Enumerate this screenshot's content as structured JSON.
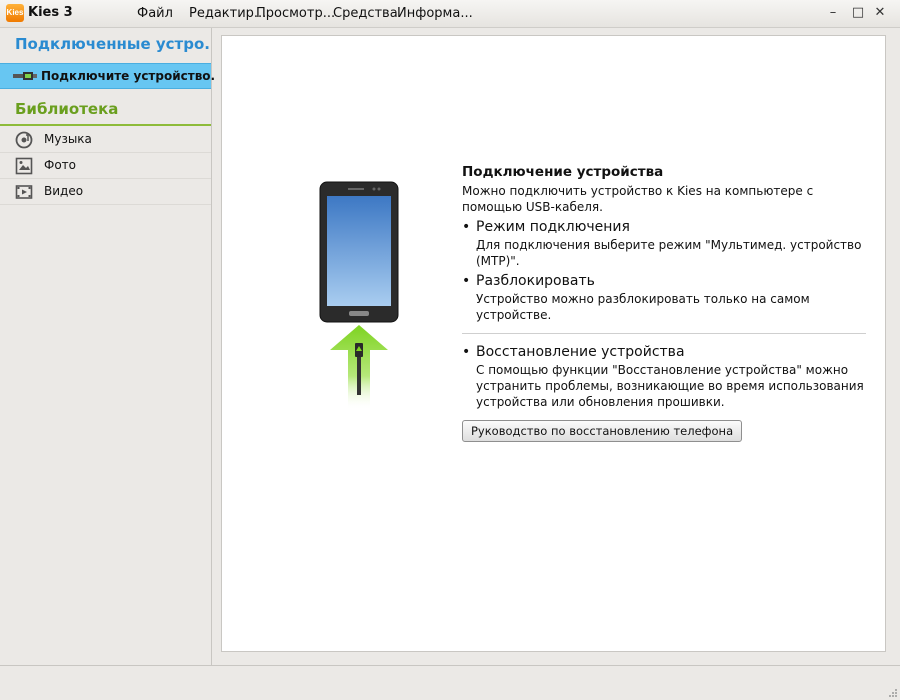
{
  "app": {
    "logo_text": "Kies",
    "title": "Kies 3",
    "accent_color": "#2a8bd1",
    "library_color": "#6a9f1e",
    "selection_color": "#67c6f2"
  },
  "menu": {
    "file": "Файл",
    "edit": "Редактир...",
    "view": "Просмотр...",
    "tools": "Средства",
    "info": "Информа..."
  },
  "window_controls": {
    "minimize": "–",
    "maximize": "□",
    "close": "✕"
  },
  "sidebar": {
    "devices_header": "Подключенные устро...",
    "device_row": "Подключите устройство.",
    "library_header": "Библиотека",
    "library_items": [
      {
        "label": "Музыка",
        "icon": "music-icon"
      },
      {
        "label": "Фото",
        "icon": "photo-icon"
      },
      {
        "label": "Видео",
        "icon": "video-icon"
      }
    ]
  },
  "content": {
    "title": "Подключение устройства",
    "intro": "Можно подключить устройство к Kies на компьютере с помощью USB-кабеля.",
    "bullets": [
      {
        "heading": "Режим подключения",
        "text": "Для подключения выберите режим \"Мультимед. устройство (MTP)\"."
      },
      {
        "heading": "Разблокировать",
        "text": "Устройство можно разблокировать только на самом устройстве."
      }
    ],
    "recovery": {
      "heading": "Восстановление устройства",
      "text": "С помощью функции \"Восстановление устройства\" можно устранить проблемы, возникающие во время использования устройства или обновления прошивки."
    },
    "guide_button": "Руководство по восстановлению телефона"
  }
}
